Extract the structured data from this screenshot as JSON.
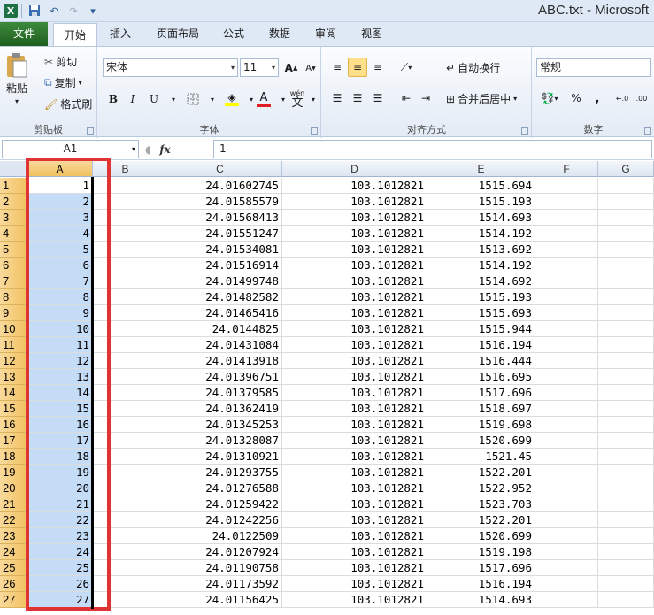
{
  "window": {
    "title": "ABC.txt  -  Microsoft"
  },
  "quick_access": [
    "save-icon",
    "undo-icon",
    "redo-icon",
    "customize-icon"
  ],
  "tabs": [
    "文件",
    "开始",
    "插入",
    "页面布局",
    "公式",
    "数据",
    "审阅",
    "视图"
  ],
  "ribbon": {
    "clipboard": {
      "paste": "粘贴",
      "cut": "剪切",
      "copy": "复制",
      "format_painter": "格式刷",
      "label": "剪贴板"
    },
    "font": {
      "name": "宋体",
      "size": "11",
      "bold": "B",
      "italic": "I",
      "underline": "U",
      "grow": "A",
      "shrink": "A",
      "label": "字体",
      "wen": "wén",
      "font_color": "A"
    },
    "alignment": {
      "wrap": "自动换行",
      "merge": "合并后居中",
      "label": "对齐方式"
    },
    "number": {
      "format": "常规",
      "percent": "%",
      "comma": ",",
      "label": "数字"
    }
  },
  "formula_bar": {
    "name_box": "A1",
    "fx": "fx",
    "value": "1"
  },
  "columns": [
    "A",
    "B",
    "C",
    "D",
    "E",
    "F",
    "G"
  ],
  "rows": [
    {
      "n": "1",
      "a": "1",
      "c": "24.01602745",
      "d": "103.1012821",
      "e": "1515.694"
    },
    {
      "n": "2",
      "a": "2",
      "c": "24.01585579",
      "d": "103.1012821",
      "e": "1515.193"
    },
    {
      "n": "3",
      "a": "3",
      "c": "24.01568413",
      "d": "103.1012821",
      "e": "1514.693"
    },
    {
      "n": "4",
      "a": "4",
      "c": "24.01551247",
      "d": "103.1012821",
      "e": "1514.192"
    },
    {
      "n": "5",
      "a": "5",
      "c": "24.01534081",
      "d": "103.1012821",
      "e": "1513.692"
    },
    {
      "n": "6",
      "a": "6",
      "c": "24.01516914",
      "d": "103.1012821",
      "e": "1514.192"
    },
    {
      "n": "7",
      "a": "7",
      "c": "24.01499748",
      "d": "103.1012821",
      "e": "1514.692"
    },
    {
      "n": "8",
      "a": "8",
      "c": "24.01482582",
      "d": "103.1012821",
      "e": "1515.193"
    },
    {
      "n": "9",
      "a": "9",
      "c": "24.01465416",
      "d": "103.1012821",
      "e": "1515.693"
    },
    {
      "n": "10",
      "a": "10",
      "c": "24.0144825",
      "d": "103.1012821",
      "e": "1515.944"
    },
    {
      "n": "11",
      "a": "11",
      "c": "24.01431084",
      "d": "103.1012821",
      "e": "1516.194"
    },
    {
      "n": "12",
      "a": "12",
      "c": "24.01413918",
      "d": "103.1012821",
      "e": "1516.444"
    },
    {
      "n": "13",
      "a": "13",
      "c": "24.01396751",
      "d": "103.1012821",
      "e": "1516.695"
    },
    {
      "n": "14",
      "a": "14",
      "c": "24.01379585",
      "d": "103.1012821",
      "e": "1517.696"
    },
    {
      "n": "15",
      "a": "15",
      "c": "24.01362419",
      "d": "103.1012821",
      "e": "1518.697"
    },
    {
      "n": "16",
      "a": "16",
      "c": "24.01345253",
      "d": "103.1012821",
      "e": "1519.698"
    },
    {
      "n": "17",
      "a": "17",
      "c": "24.01328087",
      "d": "103.1012821",
      "e": "1520.699"
    },
    {
      "n": "18",
      "a": "18",
      "c": "24.01310921",
      "d": "103.1012821",
      "e": "1521.45"
    },
    {
      "n": "19",
      "a": "19",
      "c": "24.01293755",
      "d": "103.1012821",
      "e": "1522.201"
    },
    {
      "n": "20",
      "a": "20",
      "c": "24.01276588",
      "d": "103.1012821",
      "e": "1522.952"
    },
    {
      "n": "21",
      "a": "21",
      "c": "24.01259422",
      "d": "103.1012821",
      "e": "1523.703"
    },
    {
      "n": "22",
      "a": "22",
      "c": "24.01242256",
      "d": "103.1012821",
      "e": "1522.201"
    },
    {
      "n": "23",
      "a": "23",
      "c": "24.0122509",
      "d": "103.1012821",
      "e": "1520.699"
    },
    {
      "n": "24",
      "a": "24",
      "c": "24.01207924",
      "d": "103.1012821",
      "e": "1519.198"
    },
    {
      "n": "25",
      "a": "25",
      "c": "24.01190758",
      "d": "103.1012821",
      "e": "1517.696"
    },
    {
      "n": "26",
      "a": "26",
      "c": "24.01173592",
      "d": "103.1012821",
      "e": "1516.194"
    },
    {
      "n": "27",
      "a": "27",
      "c": "24.01156425",
      "d": "103.1012821",
      "e": "1514.693"
    }
  ],
  "colors": {
    "selection": "#c5dcf7",
    "header_selected": "#f1c15f",
    "highlight_frame": "#e03333",
    "file_tab": "#2a6a2a"
  }
}
